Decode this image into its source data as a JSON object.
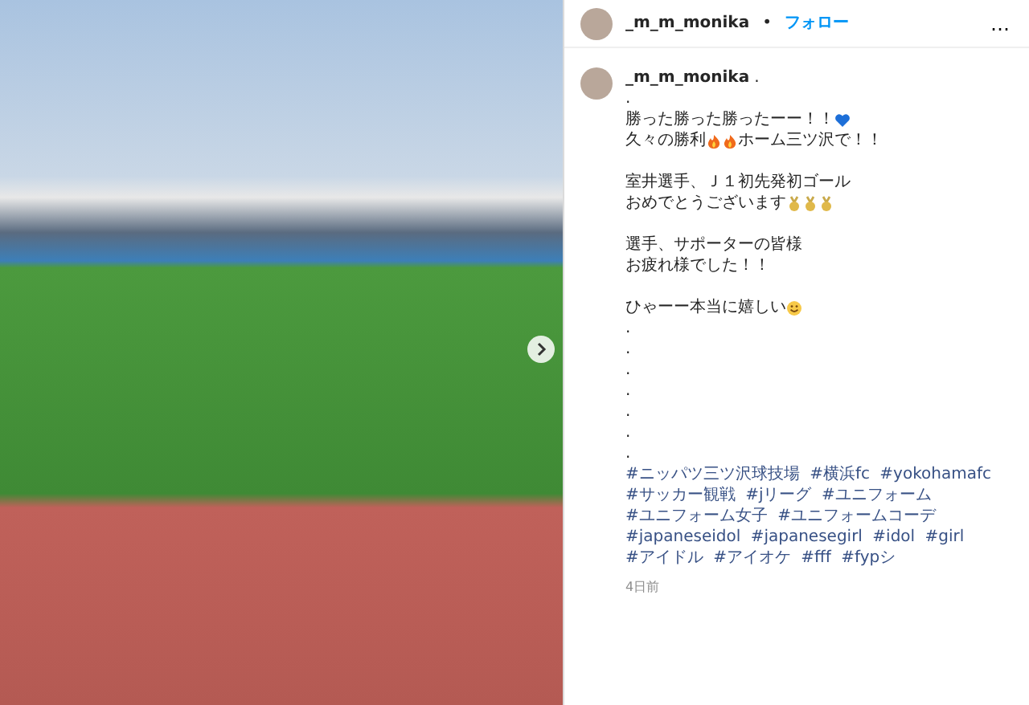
{
  "post": {
    "header": {
      "username": "_m_m_monika",
      "separator": "•",
      "follow": "フォロー",
      "more": "…"
    },
    "caption": {
      "username": "_m_m_monika",
      "username_suffix": ".",
      "paragraphs": [
        [
          [
            {
              "kind": "text",
              "text": "."
            }
          ],
          [
            {
              "kind": "text",
              "text": "勝った勝った勝ったーー！！"
            },
            {
              "kind": "heart"
            }
          ],
          [
            {
              "kind": "text",
              "text": "久々の勝利"
            },
            {
              "kind": "fire"
            },
            {
              "kind": "fire"
            },
            {
              "kind": "text",
              "text": "ホーム三ツ沢で！！"
            }
          ]
        ],
        [
          [
            {
              "kind": "text",
              "text": "室井選手、Ｊ１初先発初ゴール"
            }
          ],
          [
            {
              "kind": "text",
              "text": "おめでとうございます"
            },
            {
              "kind": "medal"
            },
            {
              "kind": "medal"
            },
            {
              "kind": "medal"
            }
          ]
        ],
        [
          [
            {
              "kind": "text",
              "text": "選手、サポーターの皆様"
            }
          ],
          [
            {
              "kind": "text",
              "text": "お疲れ様でした！！"
            }
          ]
        ],
        [
          [
            {
              "kind": "text",
              "text": "ひゃーー本当に嬉しい"
            },
            {
              "kind": "smile"
            }
          ],
          [
            {
              "kind": "text",
              "text": "."
            }
          ],
          [
            {
              "kind": "text",
              "text": "."
            }
          ],
          [
            {
              "kind": "text",
              "text": "."
            }
          ],
          [
            {
              "kind": "text",
              "text": "."
            }
          ],
          [
            {
              "kind": "text",
              "text": "."
            }
          ],
          [
            {
              "kind": "text",
              "text": "."
            }
          ],
          [
            {
              "kind": "text",
              "text": "."
            }
          ]
        ]
      ],
      "hashtags": [
        "#ニッパツ三ツ沢球技場",
        "#横浜fc",
        "#yokohamafc",
        "#サッカー観戦",
        "#jリーグ",
        "#ユニフォーム",
        "#ユニフォーム女子",
        "#ユニフォームコーデ",
        "#japaneseidol",
        "#japanesegirl",
        "#idol",
        "#girl",
        "#アイドル",
        "#アイオケ",
        "#fff",
        "#fypシ"
      ],
      "time": "4日前"
    }
  }
}
